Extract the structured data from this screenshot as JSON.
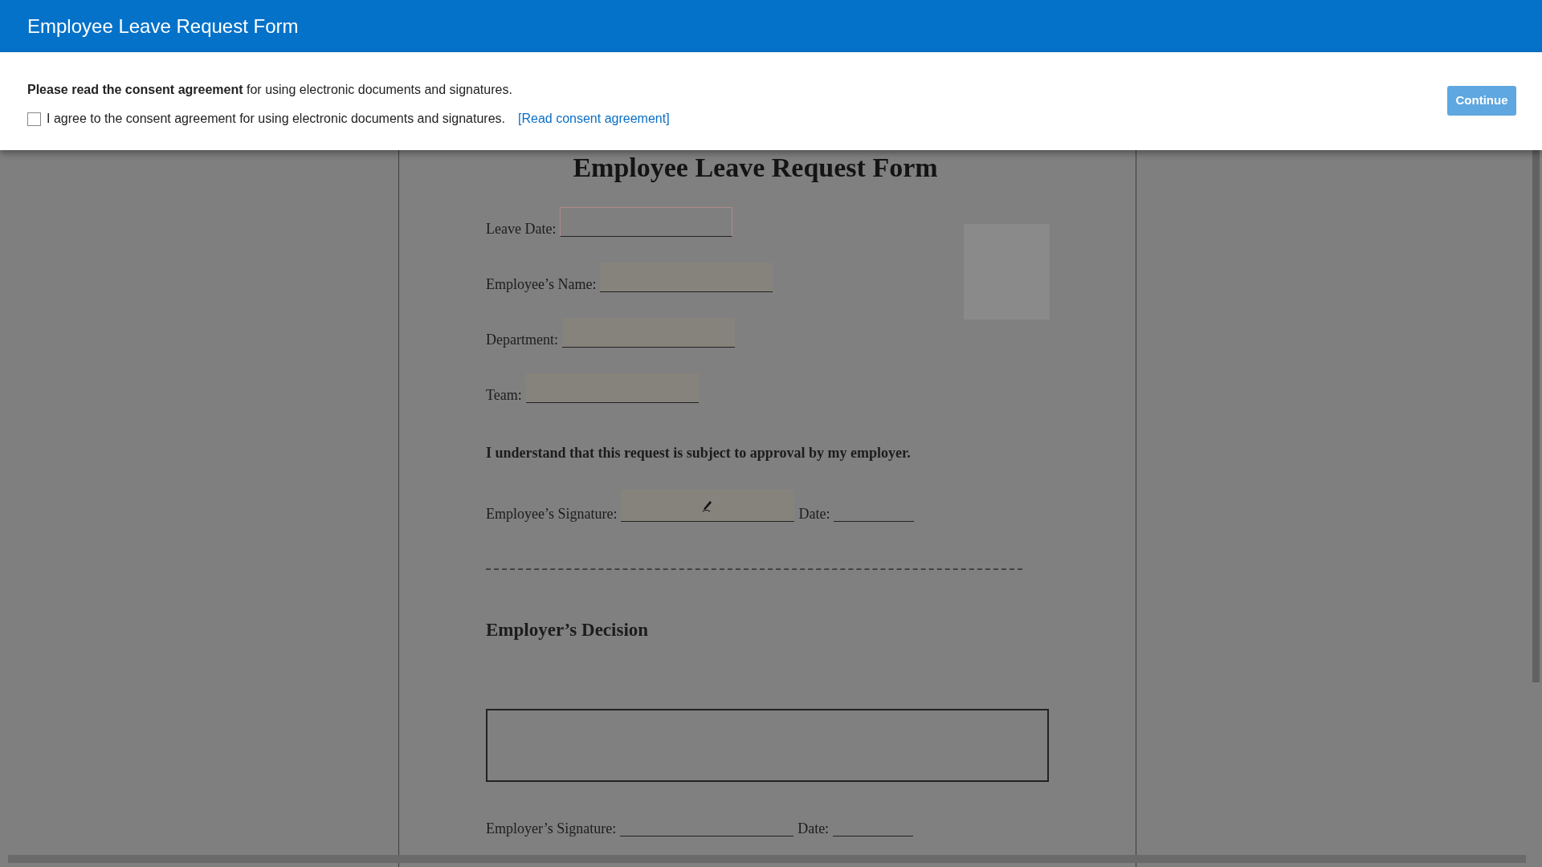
{
  "window": {
    "title": "Employee Leave Request Form"
  },
  "consent": {
    "message": "**Please read the consent agreement** for using electronic documents and signatures.",
    "checkbox_label": "I agree to the consent agreement for using electronic documents and signatures.",
    "checked": false,
    "link": "[Read consent agreement]",
    "button": "Continue"
  },
  "document": {
    "title": "Employee Leave Request Form",
    "fields": [
      {
        "label": "Leave Date:",
        "active": true
      },
      {
        "label": "Employee’s Name:",
        "active": false
      },
      {
        "label": "Department:",
        "active": false
      },
      {
        "label": "Team:",
        "active": false
      }
    ],
    "statement": "I understand that this request is subject to approval by my employer.",
    "employee_signature": {
      "label": "Employee’s Signature:",
      "date_label": "Date:"
    },
    "section_title": "Employer’s Decision",
    "employer_signature": {
      "label": "Employer’s Signature:",
      "date_label": "Date:"
    }
  }
}
